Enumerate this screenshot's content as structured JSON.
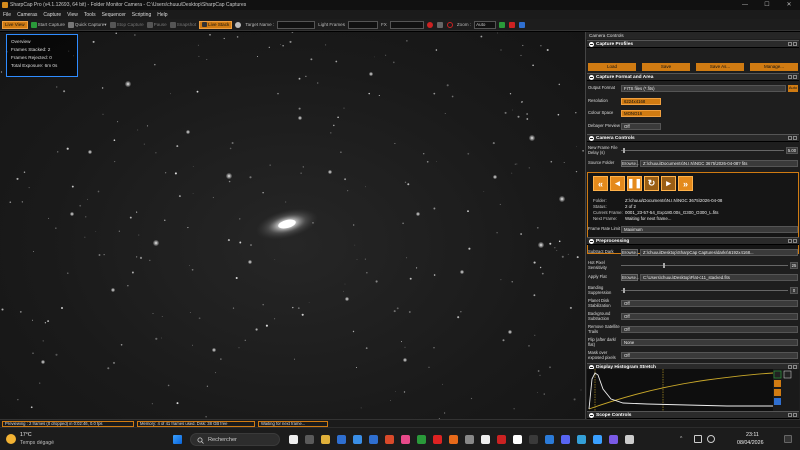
{
  "window": {
    "title": "SharpCap Pro (v4.1.12693, 64 bit) - Folder Monitor Camera - C:\\Users\\chuuu\\Desktop\\SharpCap Captures",
    "controls": [
      "—",
      "☐",
      "✕"
    ]
  },
  "menu": [
    "File",
    "Cameras",
    "Capture",
    "View",
    "Tools",
    "Sequencer",
    "Scripting",
    "Help"
  ],
  "toolbar": {
    "live_view": "Live View",
    "start_capture": "Start Capture",
    "quick_capture": "Quick Capture",
    "stop_capture": "Stop Capture",
    "pause": "Pause",
    "snapshot": "Snapshot",
    "live_stack": "Live Stack",
    "target_name_label": "Target Name :",
    "light_frames": "Light Frames",
    "fx_label": "FX",
    "zoom_label": "Zoom :",
    "zoom_value": "Auto"
  },
  "overview": {
    "title": "Overview",
    "frames_stacked": "Frames Stacked:  2",
    "frames_rejected": "Frames Rejected:  0",
    "total_exposure": "Total Exposure:     6m 0s"
  },
  "panel": {
    "title": "Camera Controls",
    "capture_profiles": {
      "header": "Capture Profiles",
      "buttons": [
        "Load",
        "Save",
        "Save As...",
        "Manage..."
      ]
    },
    "format": {
      "header": "Capture Format and Area",
      "output_format_label": "Output Format",
      "output_format_value": "FITS files (*.fits)",
      "auto": "Auto",
      "resolution_label": "Resolution",
      "resolution_value": "6224x4168",
      "colour_space_label": "Colour Space",
      "colour_space_value": "MONO16",
      "debayer_label": "Debayer Preview",
      "debayer_value": "Off"
    },
    "camera_controls": {
      "header": "Camera Controls",
      "new_frame_delay_label": "New Frame File Delay (s)",
      "new_frame_delay_value": "5.00",
      "source_folder_label": "Source Folder",
      "browse": "Browse...",
      "source_folder_value": "Z:\\chuuu\\Documents\\N.I.N\\NGC 3675\\2026-04-08? fits",
      "folder_label": "Folder:",
      "folder_value": "Z:\\chuuu\\Documents\\N.I.N\\NGC 3675\\2026-04-08",
      "status_label": "Status:",
      "status_value": "2 of 2",
      "current_frame_label": "Current Frame:",
      "current_frame_value": "0001_23-57-54_Exp180.00s_G300_O300_L.fits",
      "next_frame_label": "Next Frame:",
      "next_frame_value": "Waiting for next frame...",
      "frame_rate_label": "Frame Rate Limit",
      "frame_rate_value": "Maximum"
    },
    "preprocessing": {
      "header": "Preprocessing",
      "subtract_dark_label": "Subtract Dark",
      "subtract_dark_value": "Z:\\chuuu\\Desktop\\SharpCap Captures\\darks\\6192x4168...",
      "hot_pixel_label": "Hot Pixel Sensitivity",
      "hot_pixel_value": "25",
      "apply_flat_label": "Apply Flat",
      "apply_flat_value": "C:\\Users\\chuuu\\Desktop\\Flat-c11_stacked.fits",
      "banding_label": "Banding Suppression",
      "banding_value": "0",
      "planet_disk_label": "Planet Disk Stabilization",
      "planet_disk_value": "Off",
      "background_label": "Background Subtraction",
      "background_value": "Off",
      "remove_satellite_label": "Remove Satellite Trails",
      "remove_satellite_value": "Off",
      "flip_label": "Flip (after dark/ flat)",
      "flip_value": "None",
      "mask_label": "Mask over exposed pixels",
      "mask_value": "Off"
    },
    "histogram": {
      "header": "Display Histogram Stretch"
    },
    "scope": {
      "header": "Scope Controls"
    }
  },
  "status": {
    "previewing": "Previewing : 2 frames (0 dropped) in 0:02:46, 0.0 fps",
    "memory": "Memory: 4 of 41 frames used. Disk: 38 GB free",
    "waiting": "Waiting for next frame..."
  },
  "taskbar": {
    "weather_temp": "17°C",
    "weather_desc": "Temps dégagé",
    "search_placeholder": "Rechercher",
    "time": "23:11",
    "date": "08/04/2026"
  },
  "colors": {
    "accent": "#d07b12",
    "overview_border": "#2f8cff"
  }
}
